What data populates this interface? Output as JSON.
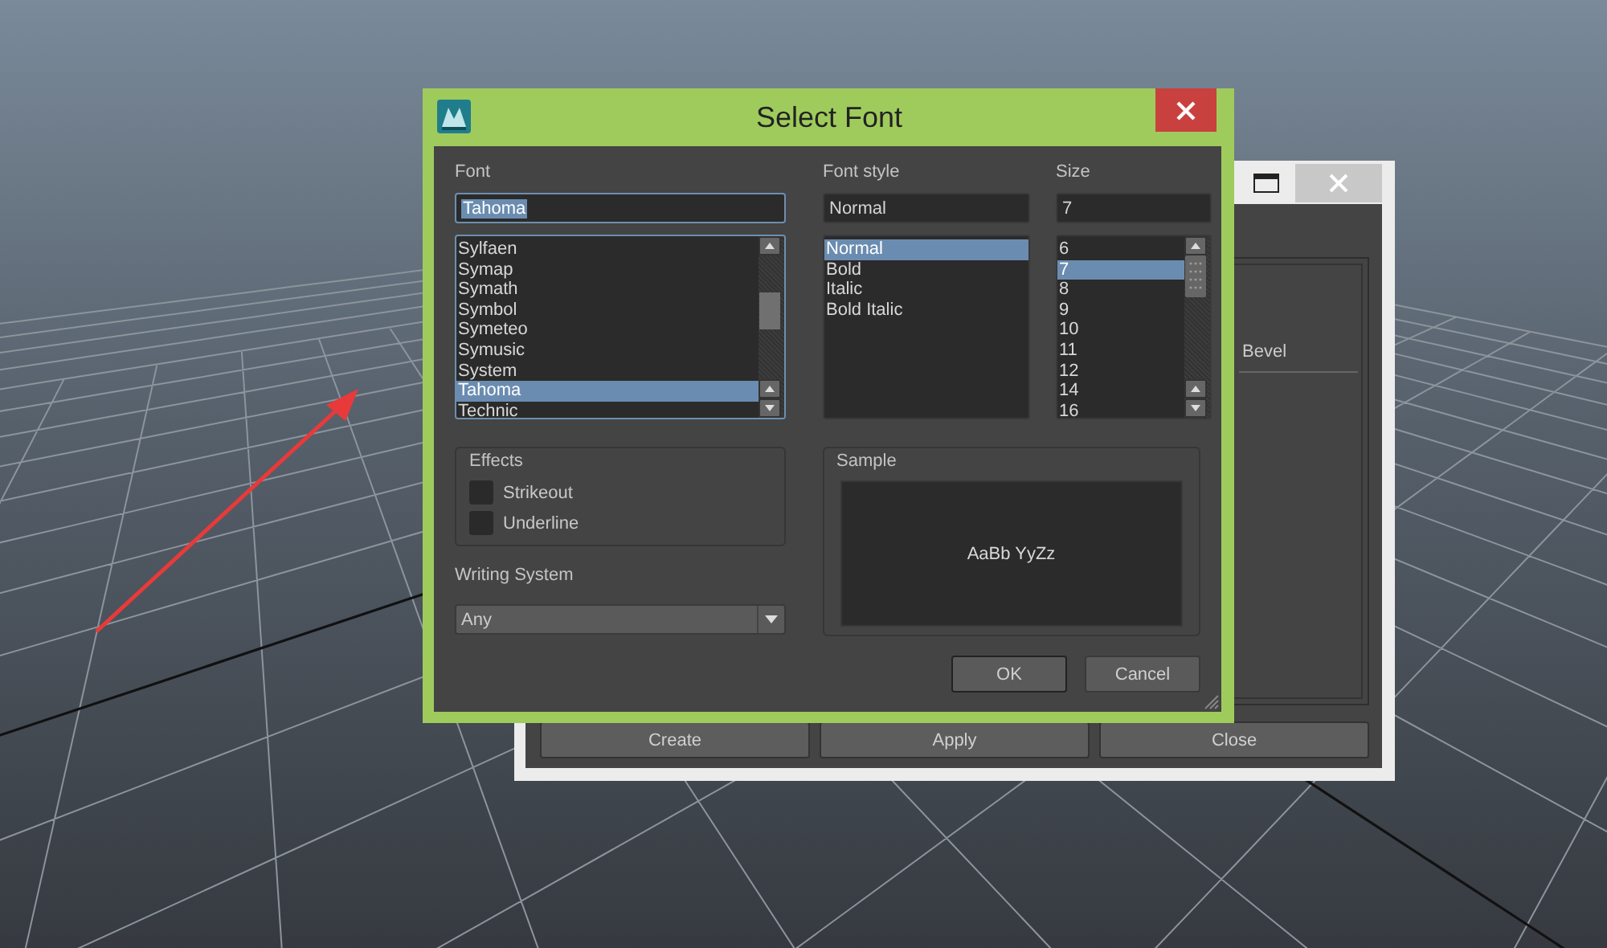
{
  "background_window": {
    "label": "Bevel",
    "buttons": [
      {
        "label": "Create"
      },
      {
        "label": "Apply"
      },
      {
        "label": "Close"
      }
    ]
  },
  "dialog": {
    "title": "Select Font",
    "font": {
      "label": "Font",
      "value": "Tahoma",
      "text_selected": true,
      "items": [
        {
          "label": "Sylfaen",
          "selected": false
        },
        {
          "label": "Symap",
          "selected": false
        },
        {
          "label": "Symath",
          "selected": false
        },
        {
          "label": "Symbol",
          "selected": false
        },
        {
          "label": "Symeteo",
          "selected": false
        },
        {
          "label": "Symusic",
          "selected": false
        },
        {
          "label": "System",
          "selected": false
        },
        {
          "label": "Tahoma",
          "selected": true
        },
        {
          "label": "Technic",
          "selected": false
        }
      ]
    },
    "font_style": {
      "label": "Font style",
      "value": "Normal",
      "text_selected": false,
      "items": [
        {
          "label": "Normal",
          "selected": true
        },
        {
          "label": "Bold",
          "selected": false
        },
        {
          "label": "Italic",
          "selected": false
        },
        {
          "label": "Bold Italic",
          "selected": false
        }
      ]
    },
    "size": {
      "label": "Size",
      "value": "7",
      "text_selected": false,
      "items": [
        {
          "label": "6",
          "selected": false
        },
        {
          "label": "7",
          "selected": true
        },
        {
          "label": "8",
          "selected": false
        },
        {
          "label": "9",
          "selected": false
        },
        {
          "label": "10",
          "selected": false
        },
        {
          "label": "11",
          "selected": false
        },
        {
          "label": "12",
          "selected": false
        },
        {
          "label": "14",
          "selected": false
        },
        {
          "label": "16",
          "selected": false
        }
      ]
    },
    "effects": {
      "title": "Effects",
      "options": [
        {
          "label": "Strikeout",
          "checked": false
        },
        {
          "label": "Underline",
          "checked": false
        }
      ]
    },
    "writing_system": {
      "label": "Writing System",
      "value": "Any"
    },
    "sample": {
      "title": "Sample",
      "text": "AaBb YyZz"
    },
    "buttons": [
      {
        "label": "OK",
        "default": true
      },
      {
        "label": "Cancel",
        "default": false
      }
    ]
  }
}
